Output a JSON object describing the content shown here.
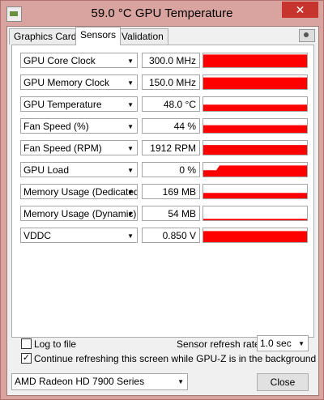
{
  "window": {
    "title": "59.0 °C GPU Temperature",
    "close_glyph": "✕"
  },
  "tabs": [
    {
      "label": "Graphics Card"
    },
    {
      "label": "Sensors"
    },
    {
      "label": "Validation"
    }
  ],
  "sensors": [
    {
      "name": "GPU Core Clock",
      "value": "300.0 MHz",
      "level": 0.92
    },
    {
      "name": "GPU Memory Clock",
      "value": "150.0 MHz",
      "level": 0.85
    },
    {
      "name": "GPU Temperature",
      "value": "48.0 °C",
      "level": 0.45
    },
    {
      "name": "Fan Speed (%)",
      "value": "44 %",
      "level": 0.55
    },
    {
      "name": "Fan Speed (RPM)",
      "value": "1912 RPM",
      "level": 0.7
    },
    {
      "name": "GPU Load",
      "value": "0 %",
      "level": 0.8
    },
    {
      "name": "Memory Usage (Dedicated)",
      "value": "169 MB",
      "level": 0.4
    },
    {
      "name": "Memory Usage (Dynamic)",
      "value": "54 MB",
      "level": 0.1
    },
    {
      "name": "VDDC",
      "value": "0.850 V",
      "level": 0.8
    }
  ],
  "options": {
    "log_to_file": {
      "label": "Log to file",
      "checked": false
    },
    "continue_refresh": {
      "label": "Continue refreshing this screen while GPU-Z is in the background",
      "checked": true
    },
    "refresh_rate_label": "Sensor refresh rate:",
    "refresh_rate_value": "1.0 sec"
  },
  "footer": {
    "gpu_select": "AMD Radeon HD 7900 Series",
    "close_label": "Close"
  },
  "colors": {
    "graph": "#ff0000",
    "titlebar": "#d9a39f",
    "close": "#c7342d"
  }
}
